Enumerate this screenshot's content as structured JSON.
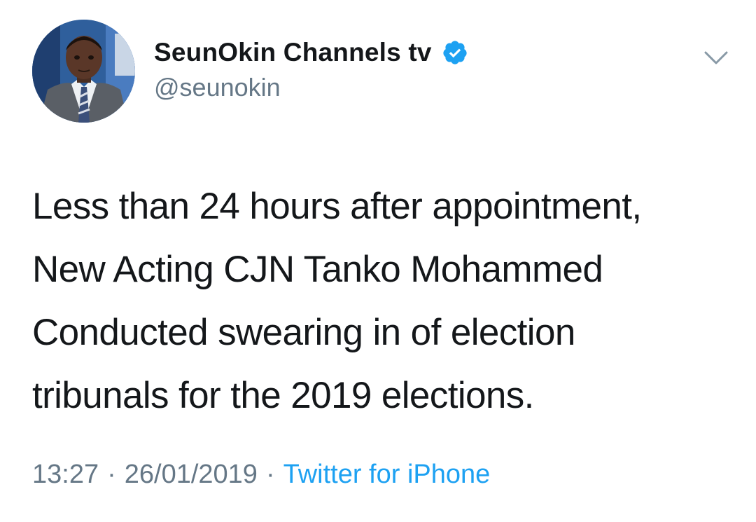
{
  "author": {
    "display_name": "SeunOkin Channels tv",
    "handle": "@seunokin",
    "verified_icon": "verified-badge-icon",
    "avatar_icon": "profile-photo"
  },
  "menu": {
    "icon": "chevron-down-icon"
  },
  "tweet": {
    "lines": [
      "Less than 24 hours after appointment,",
      "New Acting CJN Tanko Mohammed",
      "Conducted swearing in of election",
      "tribunals for the 2019 elections."
    ]
  },
  "meta": {
    "time": "13:27",
    "separator": "·",
    "date": "26/01/2019",
    "source": "Twitter for iPhone"
  },
  "colors": {
    "text": "#14171a",
    "muted": "#657786",
    "accent": "#1da1f2"
  }
}
